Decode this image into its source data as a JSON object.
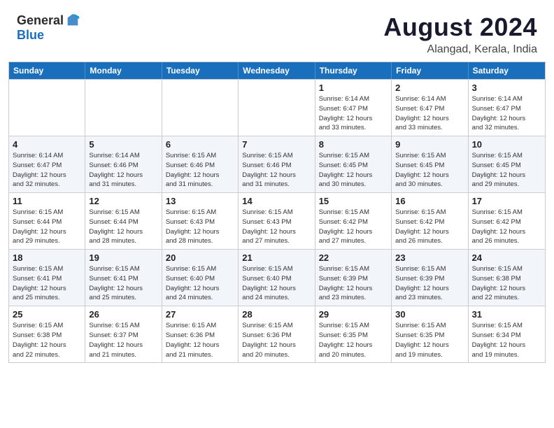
{
  "header": {
    "logo_general": "General",
    "logo_blue": "Blue",
    "month_title": "August 2024",
    "subtitle": "Alangad, Kerala, India"
  },
  "calendar": {
    "days_of_week": [
      "Sunday",
      "Monday",
      "Tuesday",
      "Wednesday",
      "Thursday",
      "Friday",
      "Saturday"
    ],
    "rows": [
      [
        {
          "day": "",
          "info": ""
        },
        {
          "day": "",
          "info": ""
        },
        {
          "day": "",
          "info": ""
        },
        {
          "day": "",
          "info": ""
        },
        {
          "day": "1",
          "info": "Sunrise: 6:14 AM\nSunset: 6:47 PM\nDaylight: 12 hours\nand 33 minutes."
        },
        {
          "day": "2",
          "info": "Sunrise: 6:14 AM\nSunset: 6:47 PM\nDaylight: 12 hours\nand 33 minutes."
        },
        {
          "day": "3",
          "info": "Sunrise: 6:14 AM\nSunset: 6:47 PM\nDaylight: 12 hours\nand 32 minutes."
        }
      ],
      [
        {
          "day": "4",
          "info": "Sunrise: 6:14 AM\nSunset: 6:47 PM\nDaylight: 12 hours\nand 32 minutes."
        },
        {
          "day": "5",
          "info": "Sunrise: 6:14 AM\nSunset: 6:46 PM\nDaylight: 12 hours\nand 31 minutes."
        },
        {
          "day": "6",
          "info": "Sunrise: 6:15 AM\nSunset: 6:46 PM\nDaylight: 12 hours\nand 31 minutes."
        },
        {
          "day": "7",
          "info": "Sunrise: 6:15 AM\nSunset: 6:46 PM\nDaylight: 12 hours\nand 31 minutes."
        },
        {
          "day": "8",
          "info": "Sunrise: 6:15 AM\nSunset: 6:45 PM\nDaylight: 12 hours\nand 30 minutes."
        },
        {
          "day": "9",
          "info": "Sunrise: 6:15 AM\nSunset: 6:45 PM\nDaylight: 12 hours\nand 30 minutes."
        },
        {
          "day": "10",
          "info": "Sunrise: 6:15 AM\nSunset: 6:45 PM\nDaylight: 12 hours\nand 29 minutes."
        }
      ],
      [
        {
          "day": "11",
          "info": "Sunrise: 6:15 AM\nSunset: 6:44 PM\nDaylight: 12 hours\nand 29 minutes."
        },
        {
          "day": "12",
          "info": "Sunrise: 6:15 AM\nSunset: 6:44 PM\nDaylight: 12 hours\nand 28 minutes."
        },
        {
          "day": "13",
          "info": "Sunrise: 6:15 AM\nSunset: 6:43 PM\nDaylight: 12 hours\nand 28 minutes."
        },
        {
          "day": "14",
          "info": "Sunrise: 6:15 AM\nSunset: 6:43 PM\nDaylight: 12 hours\nand 27 minutes."
        },
        {
          "day": "15",
          "info": "Sunrise: 6:15 AM\nSunset: 6:42 PM\nDaylight: 12 hours\nand 27 minutes."
        },
        {
          "day": "16",
          "info": "Sunrise: 6:15 AM\nSunset: 6:42 PM\nDaylight: 12 hours\nand 26 minutes."
        },
        {
          "day": "17",
          "info": "Sunrise: 6:15 AM\nSunset: 6:42 PM\nDaylight: 12 hours\nand 26 minutes."
        }
      ],
      [
        {
          "day": "18",
          "info": "Sunrise: 6:15 AM\nSunset: 6:41 PM\nDaylight: 12 hours\nand 25 minutes."
        },
        {
          "day": "19",
          "info": "Sunrise: 6:15 AM\nSunset: 6:41 PM\nDaylight: 12 hours\nand 25 minutes."
        },
        {
          "day": "20",
          "info": "Sunrise: 6:15 AM\nSunset: 6:40 PM\nDaylight: 12 hours\nand 24 minutes."
        },
        {
          "day": "21",
          "info": "Sunrise: 6:15 AM\nSunset: 6:40 PM\nDaylight: 12 hours\nand 24 minutes."
        },
        {
          "day": "22",
          "info": "Sunrise: 6:15 AM\nSunset: 6:39 PM\nDaylight: 12 hours\nand 23 minutes."
        },
        {
          "day": "23",
          "info": "Sunrise: 6:15 AM\nSunset: 6:39 PM\nDaylight: 12 hours\nand 23 minutes."
        },
        {
          "day": "24",
          "info": "Sunrise: 6:15 AM\nSunset: 6:38 PM\nDaylight: 12 hours\nand 22 minutes."
        }
      ],
      [
        {
          "day": "25",
          "info": "Sunrise: 6:15 AM\nSunset: 6:38 PM\nDaylight: 12 hours\nand 22 minutes."
        },
        {
          "day": "26",
          "info": "Sunrise: 6:15 AM\nSunset: 6:37 PM\nDaylight: 12 hours\nand 21 minutes."
        },
        {
          "day": "27",
          "info": "Sunrise: 6:15 AM\nSunset: 6:36 PM\nDaylight: 12 hours\nand 21 minutes."
        },
        {
          "day": "28",
          "info": "Sunrise: 6:15 AM\nSunset: 6:36 PM\nDaylight: 12 hours\nand 20 minutes."
        },
        {
          "day": "29",
          "info": "Sunrise: 6:15 AM\nSunset: 6:35 PM\nDaylight: 12 hours\nand 20 minutes."
        },
        {
          "day": "30",
          "info": "Sunrise: 6:15 AM\nSunset: 6:35 PM\nDaylight: 12 hours\nand 19 minutes."
        },
        {
          "day": "31",
          "info": "Sunrise: 6:15 AM\nSunset: 6:34 PM\nDaylight: 12 hours\nand 19 minutes."
        }
      ]
    ]
  }
}
